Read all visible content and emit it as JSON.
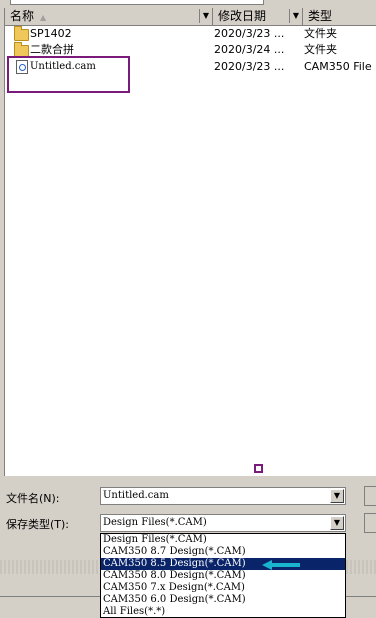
{
  "columns": {
    "name": "名称",
    "date": "修改日期",
    "type": "类型"
  },
  "files": [
    {
      "name": "SP1402",
      "date": "2020/3/23 ...",
      "type": "文件夹",
      "icon": "folder-icon"
    },
    {
      "name": "二款合拼",
      "date": "2020/3/24 ...",
      "type": "文件夹",
      "icon": "folder-icon"
    },
    {
      "name": "Untitled.cam",
      "date": "2020/3/23 ...",
      "type": "CAM350 File",
      "icon": "cam-file-icon"
    }
  ],
  "filename": {
    "label": "文件名(N):",
    "value": "Untitled.cam"
  },
  "filetype": {
    "label": "保存类型(T):",
    "value": "Design Files(*.CAM)",
    "options": [
      "Design Files(*.CAM)",
      "CAM350 8.7 Design(*.CAM)",
      "CAM350 8.5 Design(*.CAM)",
      "CAM350 8.0 Design(*.CAM)",
      "CAM350 7.x Design(*.CAM)",
      "CAM350 6.0 Design(*.CAM)",
      "All Files(*.*)"
    ],
    "selected_index": 2
  },
  "colors": {
    "selection": "#0a246a",
    "annotation_box": "#7a1a7a",
    "annotation_arrow": "#19b5d0"
  }
}
